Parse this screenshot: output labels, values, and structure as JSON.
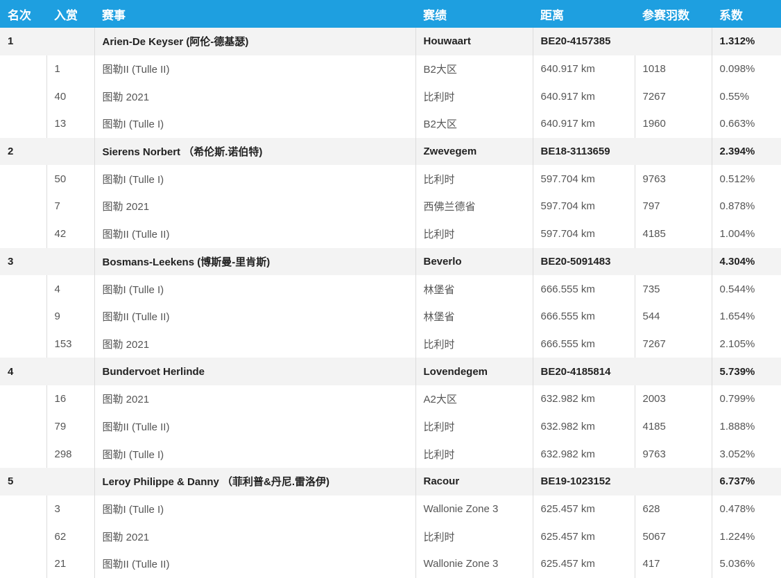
{
  "headers": [
    "名次",
    "入赏",
    "赛事",
    "赛绩",
    "距离",
    "参赛羽数",
    "系数"
  ],
  "groups": [
    {
      "rank": "1",
      "name": "Arien-De Keyser (阿伦-德基瑟)",
      "location": "Houwaart",
      "ring": "BE20-4157385",
      "coefficient": "1.312%",
      "details": [
        {
          "prize": "1",
          "race": "图勒II (Tulle II)",
          "region": "B2大区",
          "distance": "640.917 km",
          "birds": "1018",
          "coef": "0.098%"
        },
        {
          "prize": "40",
          "race": "图勒 2021",
          "region": "比利时",
          "distance": "640.917 km",
          "birds": "7267",
          "coef": "0.55%"
        },
        {
          "prize": "13",
          "race": "图勒I (Tulle I)",
          "region": "B2大区",
          "distance": "640.917 km",
          "birds": "1960",
          "coef": "0.663%"
        }
      ]
    },
    {
      "rank": "2",
      "name": "Sierens Norbert （希伦斯.诺伯特)",
      "location": "Zwevegem",
      "ring": "BE18-3113659",
      "coefficient": "2.394%",
      "details": [
        {
          "prize": "50",
          "race": "图勒I (Tulle I)",
          "region": "比利时",
          "distance": "597.704 km",
          "birds": "9763",
          "coef": "0.512%"
        },
        {
          "prize": "7",
          "race": "图勒 2021",
          "region": "西佛兰德省",
          "distance": "597.704 km",
          "birds": "797",
          "coef": "0.878%"
        },
        {
          "prize": "42",
          "race": "图勒II (Tulle II)",
          "region": "比利时",
          "distance": "597.704 km",
          "birds": "4185",
          "coef": "1.004%"
        }
      ]
    },
    {
      "rank": "3",
      "name": "Bosmans-Leekens (博斯曼-里肯斯)",
      "location": "Beverlo",
      "ring": "BE20-5091483",
      "coefficient": "4.304%",
      "details": [
        {
          "prize": "4",
          "race": "图勒I (Tulle I)",
          "region": "林堡省",
          "distance": "666.555 km",
          "birds": "735",
          "coef": "0.544%"
        },
        {
          "prize": "9",
          "race": "图勒II (Tulle II)",
          "region": "林堡省",
          "distance": "666.555 km",
          "birds": "544",
          "coef": "1.654%"
        },
        {
          "prize": "153",
          "race": "图勒 2021",
          "region": "比利时",
          "distance": "666.555 km",
          "birds": "7267",
          "coef": "2.105%"
        }
      ]
    },
    {
      "rank": "4",
      "name": "Bundervoet Herlinde",
      "location": "Lovendegem",
      "ring": "BE20-4185814",
      "coefficient": "5.739%",
      "details": [
        {
          "prize": "16",
          "race": "图勒 2021",
          "region": "A2大区",
          "distance": "632.982 km",
          "birds": "2003",
          "coef": "0.799%"
        },
        {
          "prize": "79",
          "race": "图勒II (Tulle II)",
          "region": "比利时",
          "distance": "632.982 km",
          "birds": "4185",
          "coef": "1.888%"
        },
        {
          "prize": "298",
          "race": "图勒I (Tulle I)",
          "region": "比利时",
          "distance": "632.982 km",
          "birds": "9763",
          "coef": "3.052%"
        }
      ]
    },
    {
      "rank": "5",
      "name": "Leroy Philippe & Danny （菲利普&丹尼.雷洛伊)",
      "location": "Racour",
      "ring": "BE19-1023152",
      "coefficient": "6.737%",
      "details": [
        {
          "prize": "3",
          "race": "图勒I (Tulle I)",
          "region": "Wallonie Zone 3",
          "distance": "625.457 km",
          "birds": "628",
          "coef": "0.478%"
        },
        {
          "prize": "62",
          "race": "图勒 2021",
          "region": "比利时",
          "distance": "625.457 km",
          "birds": "5067",
          "coef": "1.224%"
        },
        {
          "prize": "21",
          "race": "图勒II (Tulle II)",
          "region": "Wallonie Zone 3",
          "distance": "625.457 km",
          "birds": "417",
          "coef": "5.036%"
        }
      ]
    }
  ]
}
